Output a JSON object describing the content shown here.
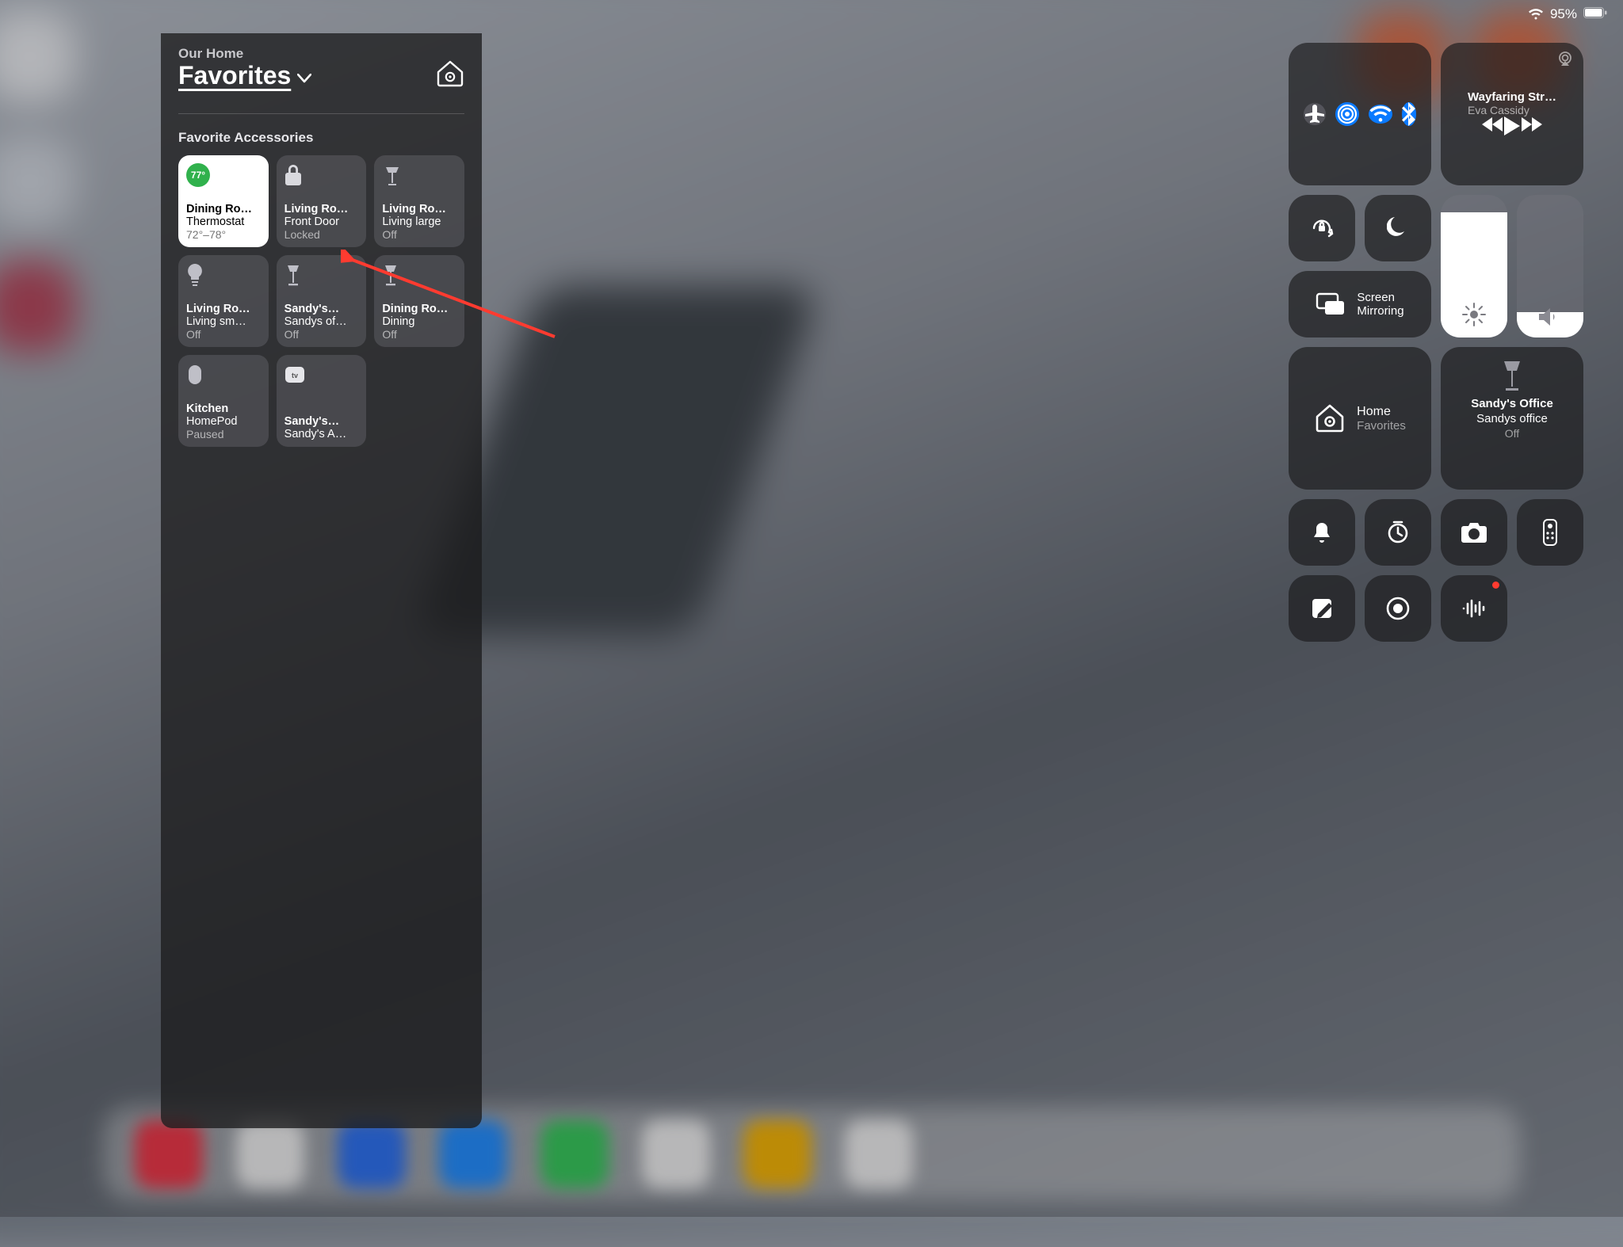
{
  "status": {
    "battery_pct": "95%"
  },
  "home_panel": {
    "home_name": "Our Home",
    "title": "Favorites",
    "section": "Favorite Accessories",
    "tiles": [
      {
        "line1": "Dining Ro…",
        "line2": "Thermostat",
        "line3": "72°–78°",
        "badge": "77°"
      },
      {
        "line1": "Living Ro…",
        "line2": "Front Door",
        "line3": "Locked"
      },
      {
        "line1": "Living Ro…",
        "line2": "Living large",
        "line3": "Off"
      },
      {
        "line1": "Living Ro…",
        "line2": "Living sm…",
        "line3": "Off"
      },
      {
        "line1": "Sandy's…",
        "line2": "Sandys of…",
        "line3": "Off"
      },
      {
        "line1": "Dining Ro…",
        "line2": "Dining",
        "line3": "Off"
      },
      {
        "line1": "Kitchen",
        "line2": "HomePod",
        "line3": "Paused"
      },
      {
        "line1": "Sandy's…",
        "line2": "Sandy's A…",
        "line3": ""
      }
    ]
  },
  "control_center": {
    "connectivity": {
      "airplane": false,
      "airdrop": true,
      "wifi": true,
      "bluetooth": true
    },
    "now_playing": {
      "song": "Wayfaring Str…",
      "artist": "Eva Cassidy"
    },
    "screen_mirroring_label_1": "Screen",
    "screen_mirroring_label_2": "Mirroring",
    "brightness_pct": 88,
    "volume_pct": 18,
    "home_tile": {
      "title": "Home",
      "subtitle": "Favorites"
    },
    "accessory_tile": {
      "line1": "Sandy's Office",
      "line2": "Sandys office",
      "line3": "Off"
    }
  },
  "colors": {
    "blue": "#0a7aff",
    "green": "#30b14c",
    "red": "#ff3b30"
  }
}
